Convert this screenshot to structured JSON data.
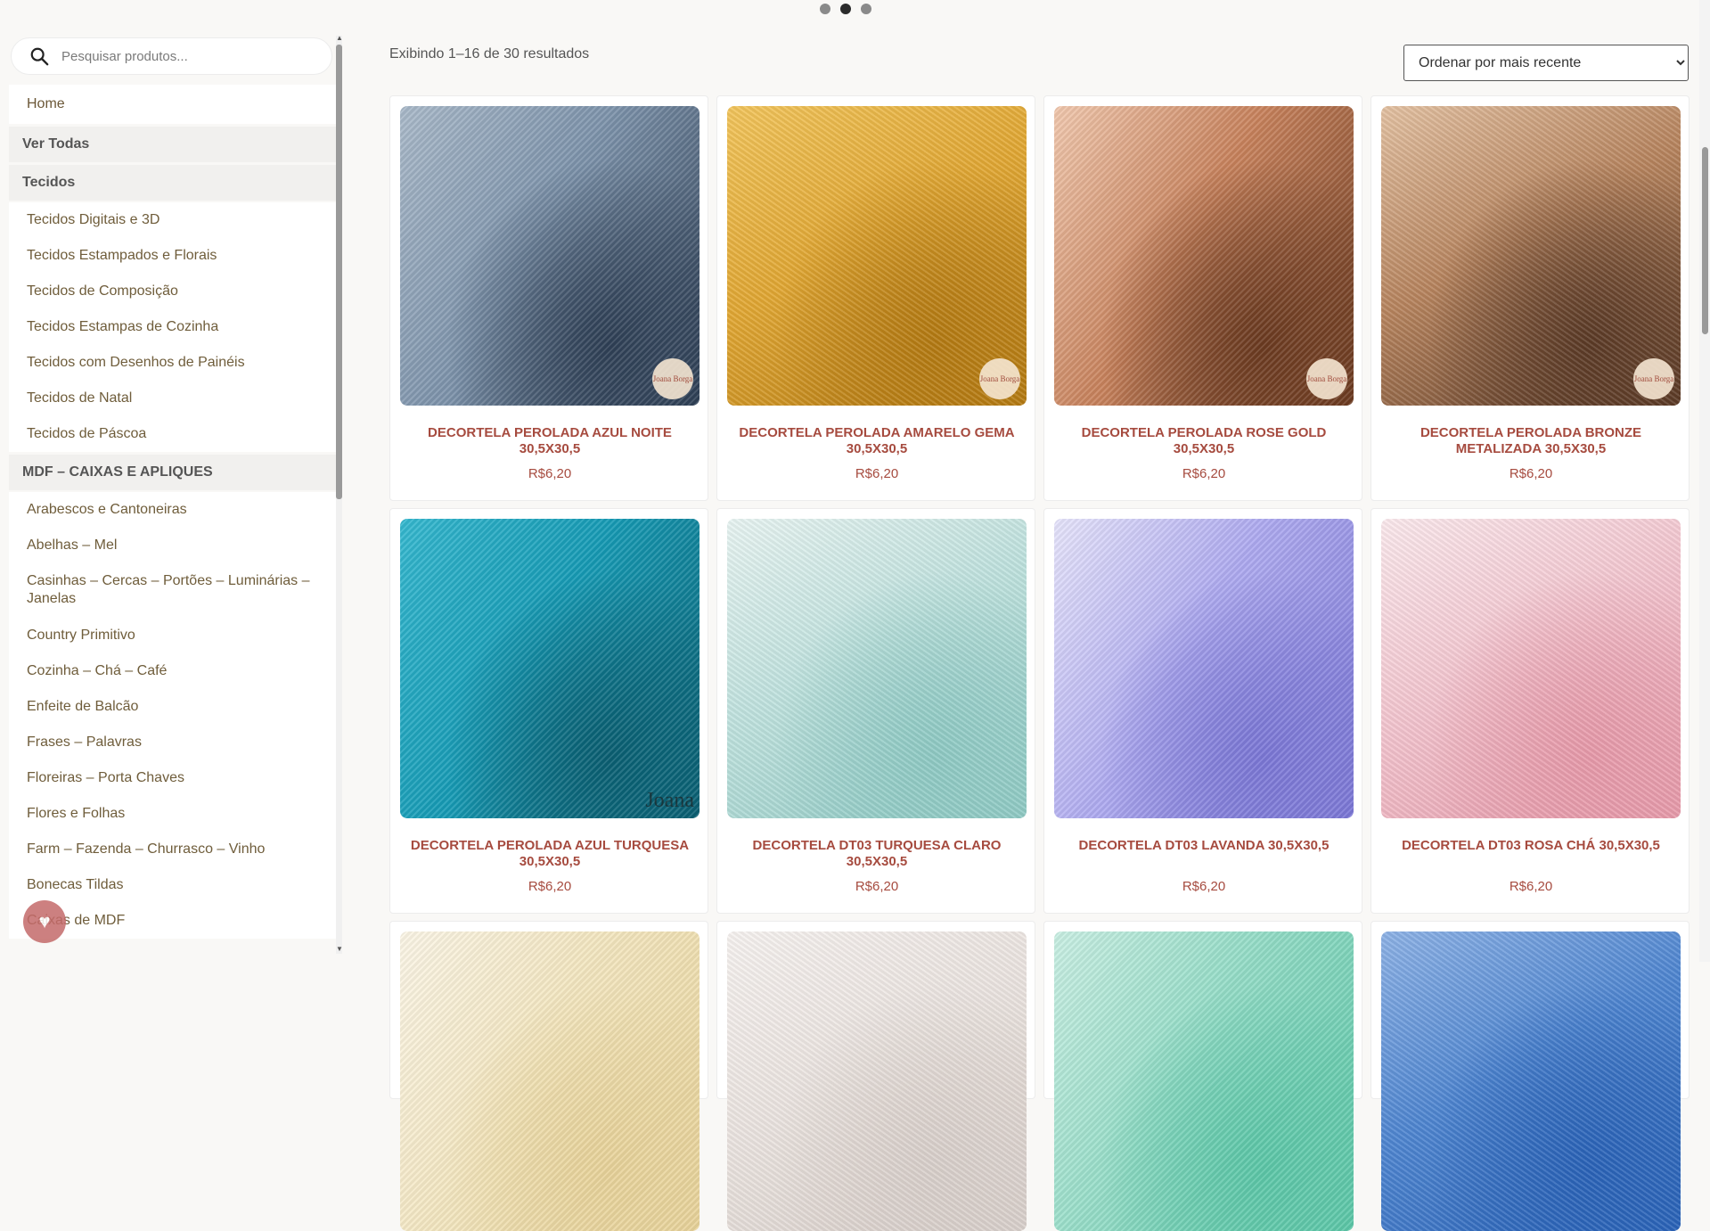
{
  "search": {
    "placeholder": "Pesquisar produtos..."
  },
  "menu": [
    {
      "label": "Home",
      "type": "home"
    },
    {
      "label": "Ver Todas",
      "type": "head"
    },
    {
      "label": "Tecidos",
      "type": "head"
    },
    {
      "label": "Tecidos Digitais e 3D",
      "type": "item"
    },
    {
      "label": "Tecidos Estampados e Florais",
      "type": "item"
    },
    {
      "label": "Tecidos de Composição",
      "type": "item"
    },
    {
      "label": "Tecidos Estampas de Cozinha",
      "type": "item"
    },
    {
      "label": "Tecidos com Desenhos de Painéis",
      "type": "item"
    },
    {
      "label": "Tecidos de Natal",
      "type": "item"
    },
    {
      "label": "Tecidos de Páscoa",
      "type": "item"
    },
    {
      "label": "MDF – CAIXAS E APLIQUES",
      "type": "head"
    },
    {
      "label": "Arabescos e Cantoneiras",
      "type": "item"
    },
    {
      "label": "Abelhas – Mel",
      "type": "item"
    },
    {
      "label": "Casinhas – Cercas – Portões – Luminárias – Janelas",
      "type": "two"
    },
    {
      "label": "Country Primitivo",
      "type": "item"
    },
    {
      "label": "Cozinha – Chá – Café",
      "type": "item"
    },
    {
      "label": "Enfeite de Balcão",
      "type": "item"
    },
    {
      "label": "Frases – Palavras",
      "type": "item"
    },
    {
      "label": "Floreiras – Porta Chaves",
      "type": "item"
    },
    {
      "label": "Flores e Folhas",
      "type": "item"
    },
    {
      "label": "Farm – Fazenda – Churrasco – Vinho",
      "type": "item"
    },
    {
      "label": "Bonecas Tildas",
      "type": "item"
    },
    {
      "label": "Caixas de MDF",
      "type": "item"
    }
  ],
  "results": {
    "count_text": "Exibindo 1–16 de 30 resultados"
  },
  "ordering": {
    "selected": "Ordenar por mais recente"
  },
  "products": [
    {
      "title": "DECORTELA PEROLADA AZUL NOITE 30,5X30,5",
      "price": "R$6,20",
      "colors": [
        "#2e3f55",
        "#7d93ab",
        "#a9b9c9"
      ],
      "mark": "badge"
    },
    {
      "title": "DECORTELA PEROLADA AMARELO GEMA 30,5X30,5",
      "price": "R$6,20",
      "colors": [
        "#b47a12",
        "#e1a733",
        "#f2c55c"
      ],
      "mark": "badge"
    },
    {
      "title": "DECORTELA PEROLADA ROSE GOLD 30,5X30,5",
      "price": "R$6,20",
      "colors": [
        "#6b3a20",
        "#c7815b",
        "#f1c8ae"
      ],
      "mark": "badge"
    },
    {
      "title": "DECORTELA PEROLADA BRONZE METALIZADA 30,5X30,5",
      "price": "R$6,20",
      "colors": [
        "#5b3a26",
        "#b6835d",
        "#e3c1a2"
      ],
      "mark": "badge"
    },
    {
      "title": "DECORTELA PEROLADA AZUL TURQUESA 30,5X30,5",
      "price": "R$6,20",
      "colors": [
        "#0a5f72",
        "#169bb5",
        "#35b8cf"
      ],
      "mark": "joana"
    },
    {
      "title": "DECORTELA DT03 TURQUESA CLARO 30,5X30,5",
      "price": "R$6,20",
      "colors": [
        "#8fcac4",
        "#bfe2de",
        "#e8f4f2"
      ],
      "mark": ""
    },
    {
      "title": "DECORTELA DT03 LAVANDA 30,5X30,5",
      "price": "R$6,20",
      "colors": [
        "#7b77d6",
        "#aeaaf0",
        "#e6e4fb"
      ],
      "mark": ""
    },
    {
      "title": "DECORTELA DT03 ROSA CHÁ 30,5X30,5",
      "price": "R$6,20",
      "colors": [
        "#e79aaa",
        "#f3c5cf",
        "#fbe9ed"
      ],
      "mark": ""
    },
    {
      "title": "",
      "price": "",
      "colors": [
        "#e8d39a",
        "#f3e6bf",
        "#fbf5e6"
      ],
      "mark": ""
    },
    {
      "title": "",
      "price": "",
      "colors": [
        "#d9d0cb",
        "#ebe4e0",
        "#f6f2f0"
      ],
      "mark": ""
    },
    {
      "title": "",
      "price": "",
      "colors": [
        "#5cc7a8",
        "#93dcc6",
        "#c9efe3"
      ],
      "mark": ""
    },
    {
      "title": "",
      "price": "",
      "colors": [
        "#2a63b8",
        "#4f86d1",
        "#8db2e6"
      ],
      "mark": ""
    }
  ],
  "badge_text": "Joana Borga",
  "watermark_text": "Joana"
}
